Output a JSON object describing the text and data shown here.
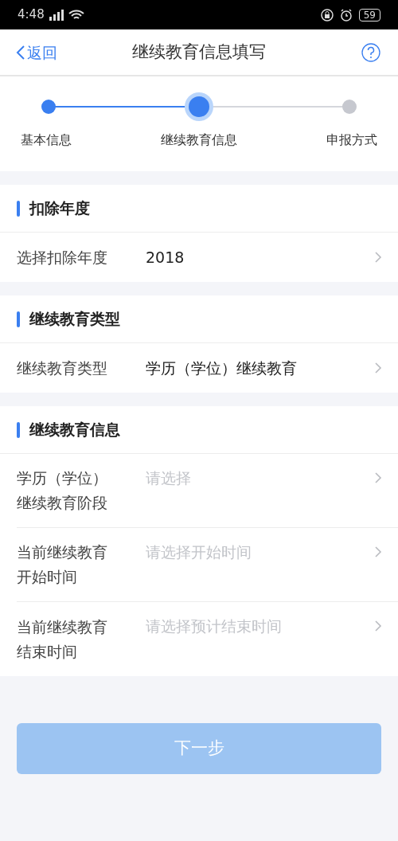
{
  "status_bar": {
    "time": "4:48",
    "battery": "59"
  },
  "header": {
    "back": "返回",
    "title": "继续教育信息填写"
  },
  "steps": [
    {
      "label": "基本信息",
      "completed": true,
      "selected": false
    },
    {
      "label": "继续教育信息",
      "completed": false,
      "selected": true
    },
    {
      "label": "申报方式",
      "completed": false,
      "selected": false
    }
  ],
  "sections": [
    {
      "title": "扣除年度",
      "rows": [
        {
          "label": "选择扣除年度",
          "value": "2018"
        }
      ]
    },
    {
      "title": "继续教育类型",
      "rows": [
        {
          "label": "继续教育类型",
          "value": "学历（学位）继续教育"
        }
      ]
    },
    {
      "title": "继续教育信息",
      "rows": [
        {
          "label": "学历（学位）继续教育阶段",
          "placeholder": "请选择"
        },
        {
          "label": "当前继续教育开始时间",
          "placeholder": "请选择开始时间"
        },
        {
          "label": "当前继续教育结束时间",
          "placeholder": "请选择预计结束时间"
        }
      ]
    }
  ],
  "next_button": {
    "label": "下一步",
    "disabled": true
  }
}
